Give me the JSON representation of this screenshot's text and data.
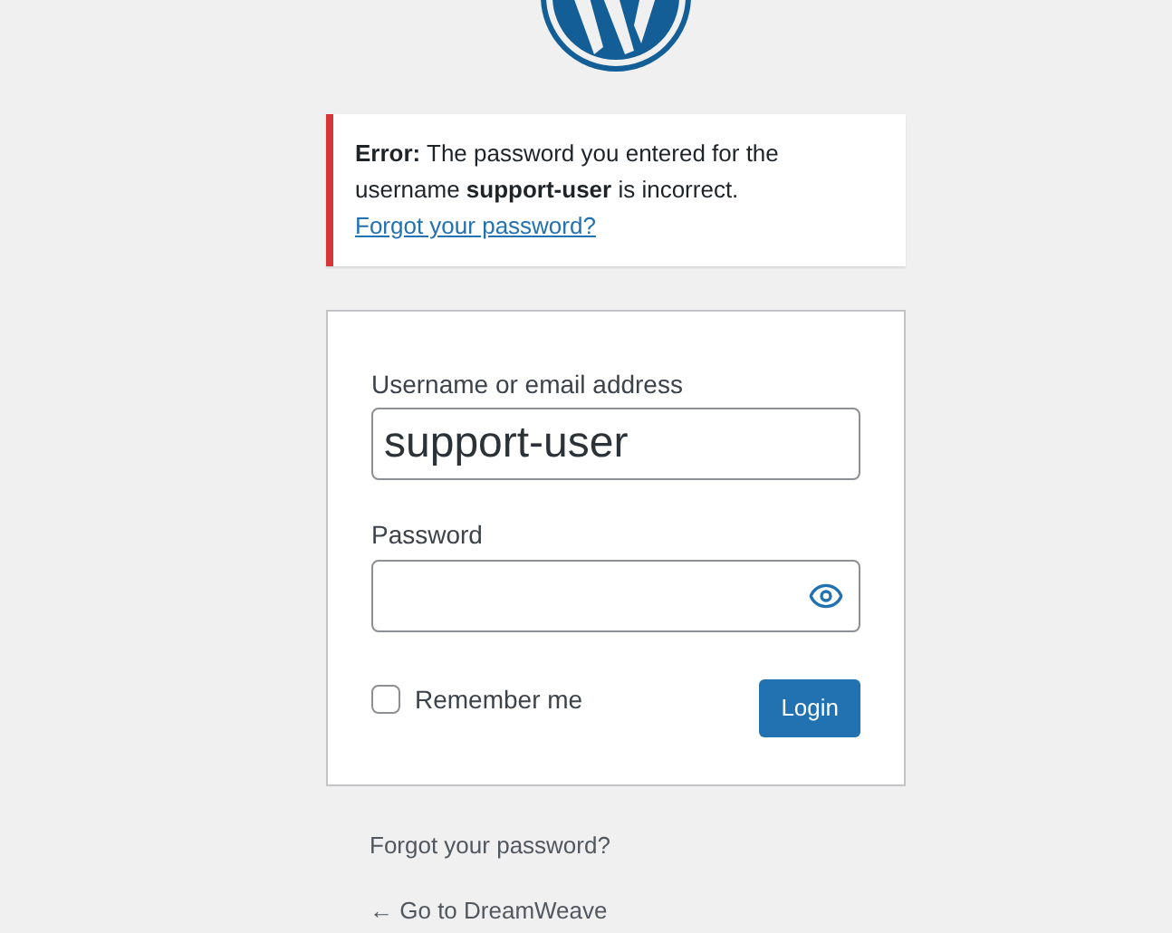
{
  "error_notice": {
    "message": "**Error:** The password you entered for the username **support-user** is incorrect.",
    "link": "Forgot your password?"
  },
  "login_form": {
    "username_label": "Username or email address",
    "username_value": "support-user",
    "password_label": "Password",
    "remember_label": "Remember me",
    "remember_checked": false,
    "submit": "Login"
  },
  "footer_links": [
    "Forgot your password?",
    "← Go to DreamWeave"
  ]
}
